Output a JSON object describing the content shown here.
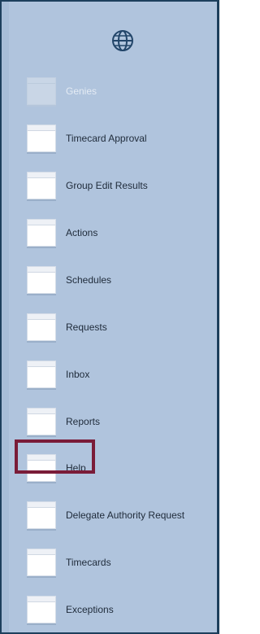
{
  "header": {
    "icon": "globe-icon"
  },
  "menu": {
    "selected_index": 10,
    "items": [
      {
        "label": "Genies",
        "state": "disabled",
        "icon": "tile-icon"
      },
      {
        "label": "Timecard Approval",
        "state": "enabled",
        "icon": "tile-icon"
      },
      {
        "label": "Group Edit Results",
        "state": "enabled",
        "icon": "tile-icon"
      },
      {
        "label": "Actions",
        "state": "enabled",
        "icon": "tile-icon"
      },
      {
        "label": "Schedules",
        "state": "enabled",
        "icon": "tile-icon"
      },
      {
        "label": "Requests",
        "state": "enabled",
        "icon": "tile-icon"
      },
      {
        "label": "Inbox",
        "state": "enabled",
        "icon": "tile-icon"
      },
      {
        "label": "Reports",
        "state": "enabled",
        "icon": "tile-icon"
      },
      {
        "label": "Help",
        "state": "enabled",
        "icon": "tile-icon"
      },
      {
        "label": "Delegate Authority Request",
        "state": "enabled",
        "icon": "tile-icon"
      },
      {
        "label": "Timecards",
        "state": "enabled",
        "icon": "tile-icon"
      },
      {
        "label": "Exceptions",
        "state": "enabled",
        "icon": "tile-icon"
      }
    ]
  },
  "colors": {
    "panel_background": "#b0c4dd",
    "panel_border": "#1d3f5c",
    "highlight_border": "#7a1c38",
    "label_text": "#1f2b3a",
    "disabled_label_text": "#e4ebf4"
  }
}
